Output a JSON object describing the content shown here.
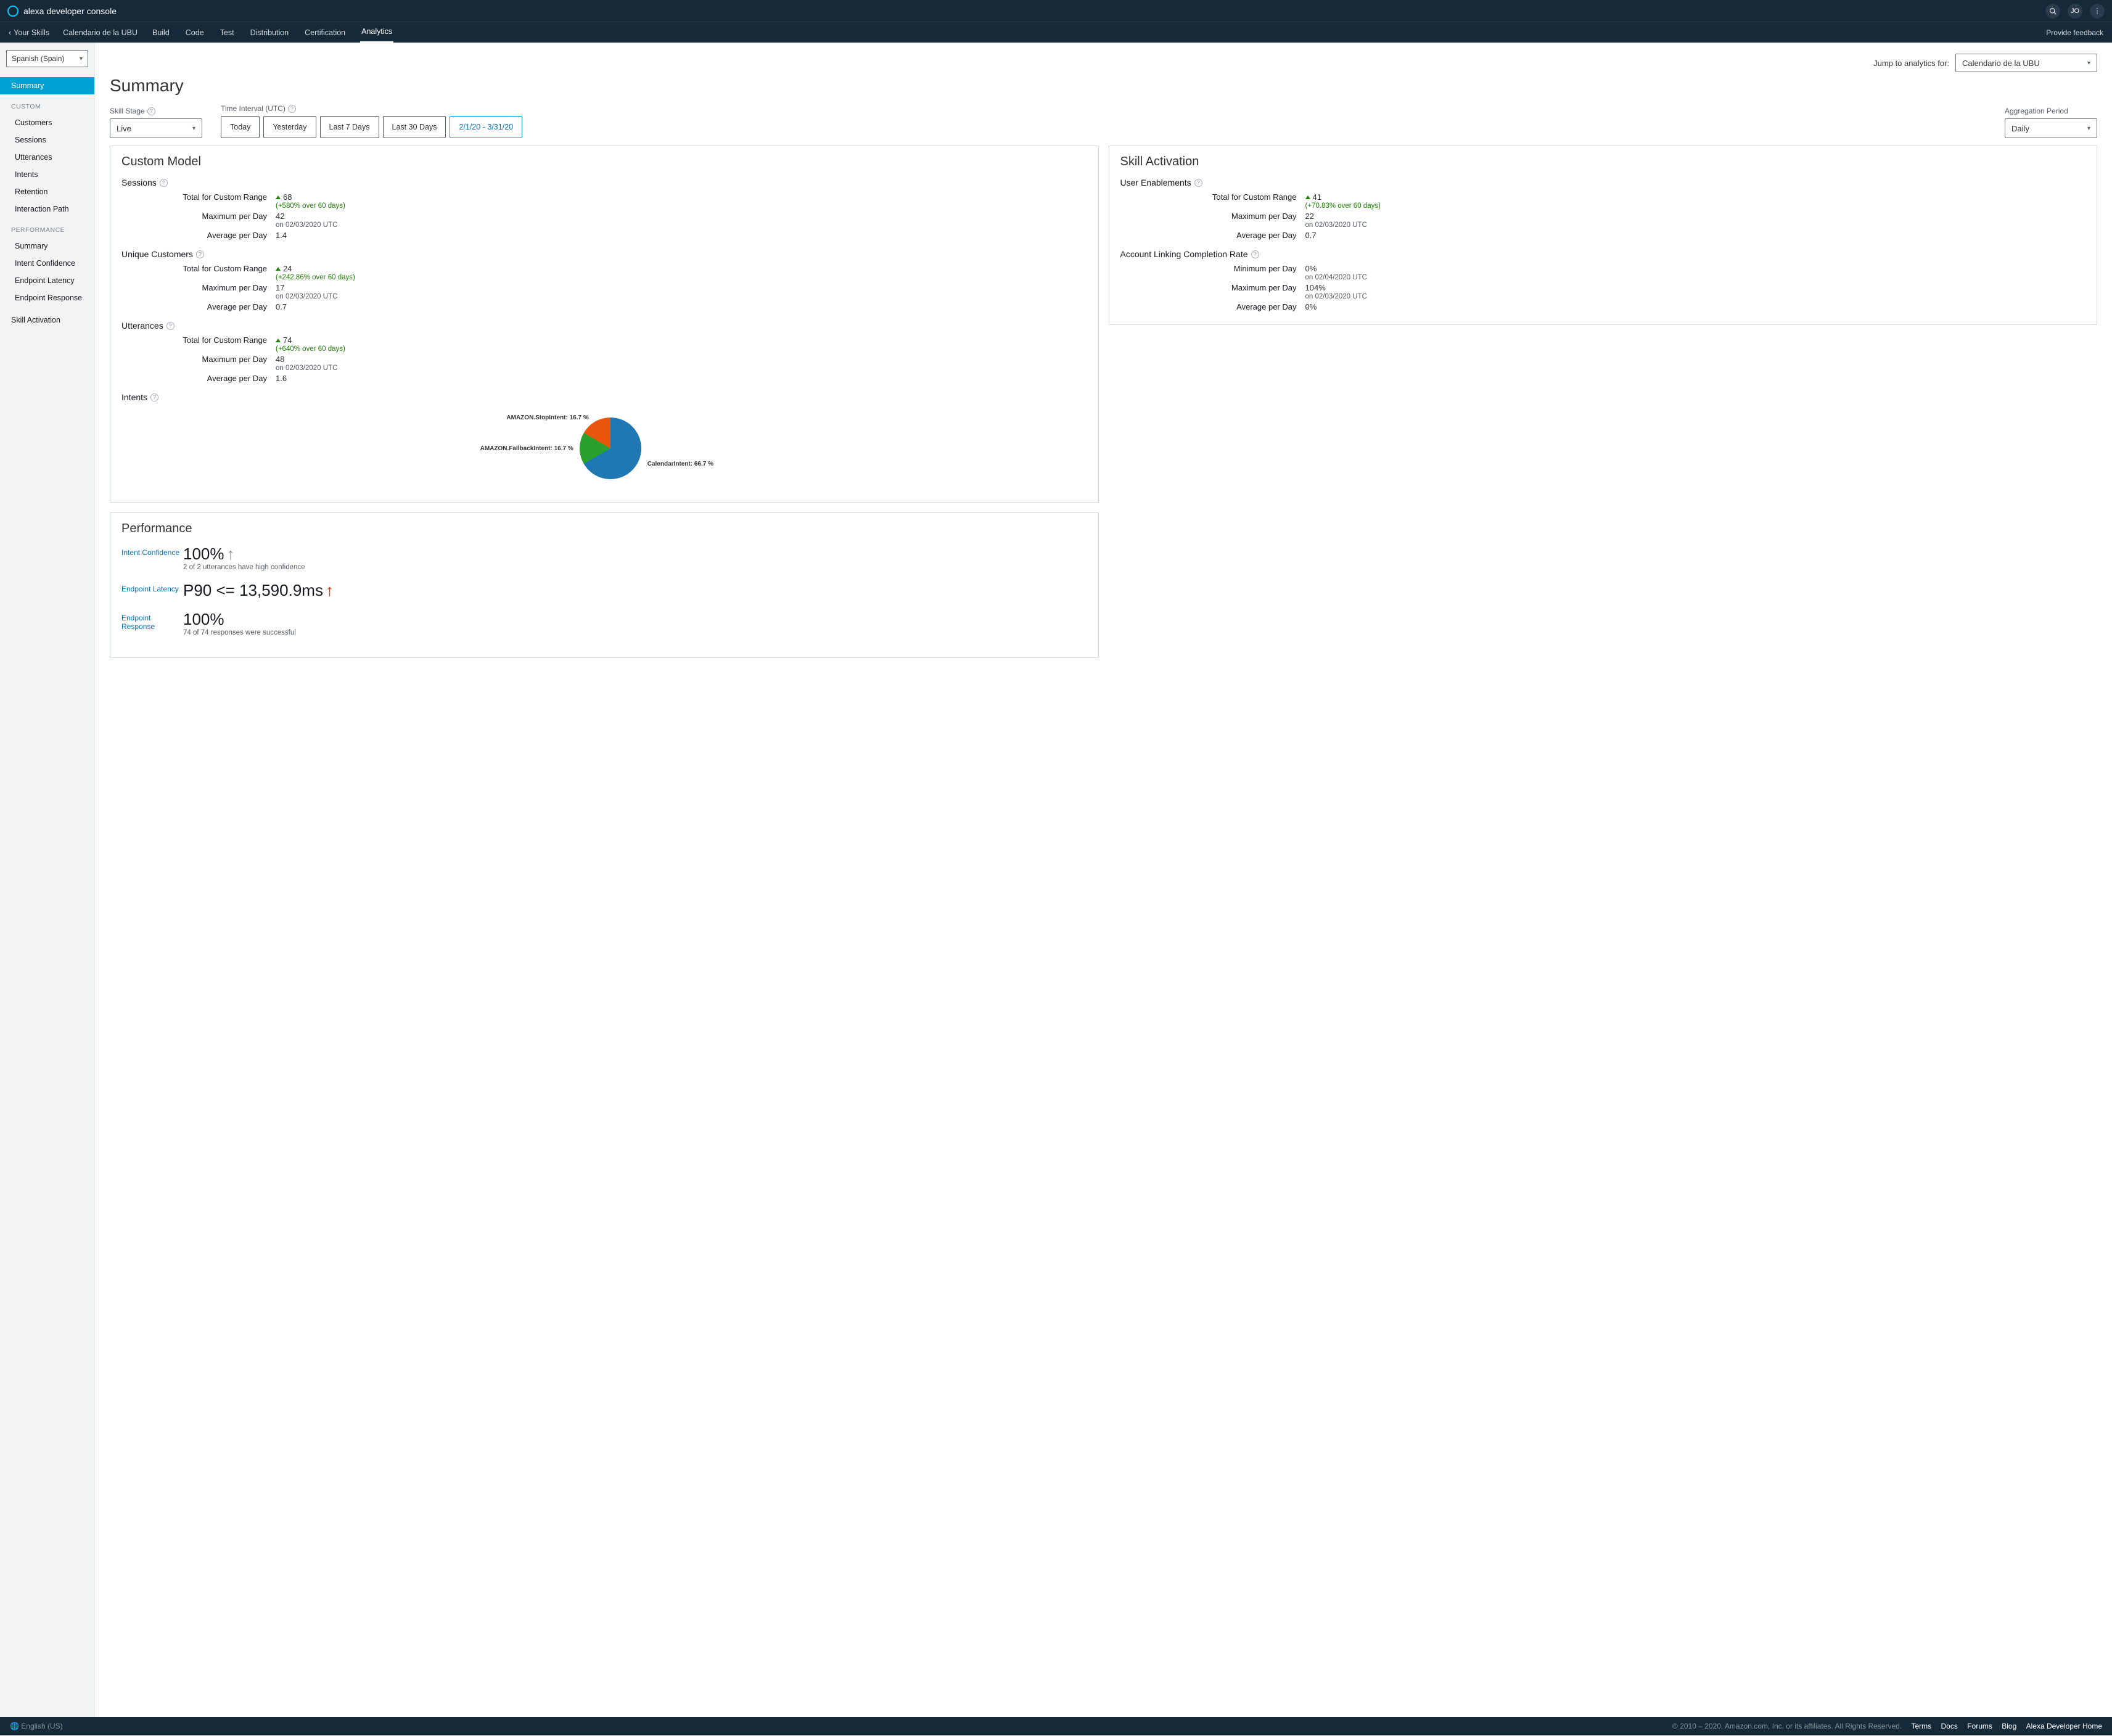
{
  "brand": "alexa developer console",
  "feedback": "Provide feedback",
  "topicons": {
    "avatar_initials": "JO"
  },
  "nav": {
    "back": "Your Skills",
    "skill_name": "Calendario de la UBU",
    "tabs": [
      "Build",
      "Code",
      "Test",
      "Distribution",
      "Certification",
      "Analytics"
    ],
    "active": "Analytics"
  },
  "sidebar": {
    "locale": "Spanish (Spain)",
    "summary": "Summary",
    "heading_custom": "CUSTOM",
    "custom_items": [
      "Customers",
      "Sessions",
      "Utterances",
      "Intents",
      "Retention",
      "Interaction Path"
    ],
    "heading_perf": "PERFORMANCE",
    "perf_items": [
      "Summary",
      "Intent Confidence",
      "Endpoint Latency",
      "Endpoint Response"
    ],
    "skill_activation": "Skill Activation"
  },
  "main": {
    "jump_label": "Jump to analytics for:",
    "jump_value": "Calendario de la UBU",
    "title": "Summary",
    "skill_stage_label": "Skill Stage",
    "skill_stage_value": "Live",
    "interval_label": "Time Interval (UTC)",
    "interval_buttons": [
      "Today",
      "Yesterday",
      "Last 7 Days",
      "Last 30 Days"
    ],
    "interval_custom": "2/1/20 - 3/31/20",
    "agg_label": "Aggregation Period",
    "agg_value": "Daily"
  },
  "custom_model": {
    "title": "Custom Model",
    "sessions": {
      "head": "Sessions",
      "total_label": "Total for Custom Range",
      "total_val": "68",
      "total_pct": "(+580% over 60 days)",
      "max_label": "Maximum per Day",
      "max_val": "42",
      "max_sub": "on 02/03/2020 UTC",
      "avg_label": "Average per Day",
      "avg_val": "1.4"
    },
    "customers": {
      "head": "Unique Customers",
      "total_label": "Total for Custom Range",
      "total_val": "24",
      "total_pct": "(+242.86% over 60 days)",
      "max_label": "Maximum per Day",
      "max_val": "17",
      "max_sub": "on 02/03/2020 UTC",
      "avg_label": "Average per Day",
      "avg_val": "0.7"
    },
    "utterances": {
      "head": "Utterances",
      "total_label": "Total for Custom Range",
      "total_val": "74",
      "total_pct": "(+640% over 60 days)",
      "max_label": "Maximum per Day",
      "max_val": "48",
      "max_sub": "on 02/03/2020 UTC",
      "avg_label": "Average per Day",
      "avg_val": "1.6"
    },
    "intents_head": "Intents"
  },
  "chart_data": {
    "type": "pie",
    "title": "Intents",
    "series": [
      {
        "name": "CalendarIntent",
        "value": 66.7,
        "color": "#1f77b4"
      },
      {
        "name": "AMAZON.FallbackIntent",
        "value": 16.7,
        "color": "#2ca02c"
      },
      {
        "name": "AMAZON.StopIntent",
        "value": 16.7,
        "color": "#e8550d"
      }
    ],
    "labels": {
      "l0": "CalendarIntent: 66.7 %",
      "l1": "AMAZON.FallbackIntent: 16.7 %",
      "l2": "AMAZON.StopIntent: 16.7 %"
    }
  },
  "skill_activation": {
    "title": "Skill Activation",
    "enablements": {
      "head": "User Enablements",
      "total_label": "Total for Custom Range",
      "total_val": "41",
      "total_pct": "(+70.83% over 60 days)",
      "max_label": "Maximum per Day",
      "max_val": "22",
      "max_sub": "on 02/03/2020 UTC",
      "avg_label": "Average per Day",
      "avg_val": "0.7"
    },
    "linking": {
      "head": "Account Linking Completion Rate",
      "min_label": "Minimum per Day",
      "min_val": "0%",
      "min_sub": "on 02/04/2020 UTC",
      "max_label": "Maximum per Day",
      "max_val": "104%",
      "max_sub": "on 02/03/2020 UTC",
      "avg_label": "Average per Day",
      "avg_val": "0%"
    }
  },
  "performance": {
    "title": "Performance",
    "rows": {
      "confidence": {
        "link": "Intent Confidence",
        "big": "100%",
        "sub": "2 of 2 utterances have high confidence"
      },
      "latency": {
        "link": "Endpoint Latency",
        "big": "P90 <= 13,590.9ms",
        "sub": ""
      },
      "response": {
        "link": "Endpoint Response",
        "big": "100%",
        "sub": "74 of 74 responses were successful"
      }
    }
  },
  "footer": {
    "lang": "English (US)",
    "copyright": "© 2010 – 2020, Amazon.com, Inc. or its affiliates. All Rights Reserved.",
    "links": [
      "Terms",
      "Docs",
      "Forums",
      "Blog",
      "Alexa Developer Home"
    ]
  }
}
